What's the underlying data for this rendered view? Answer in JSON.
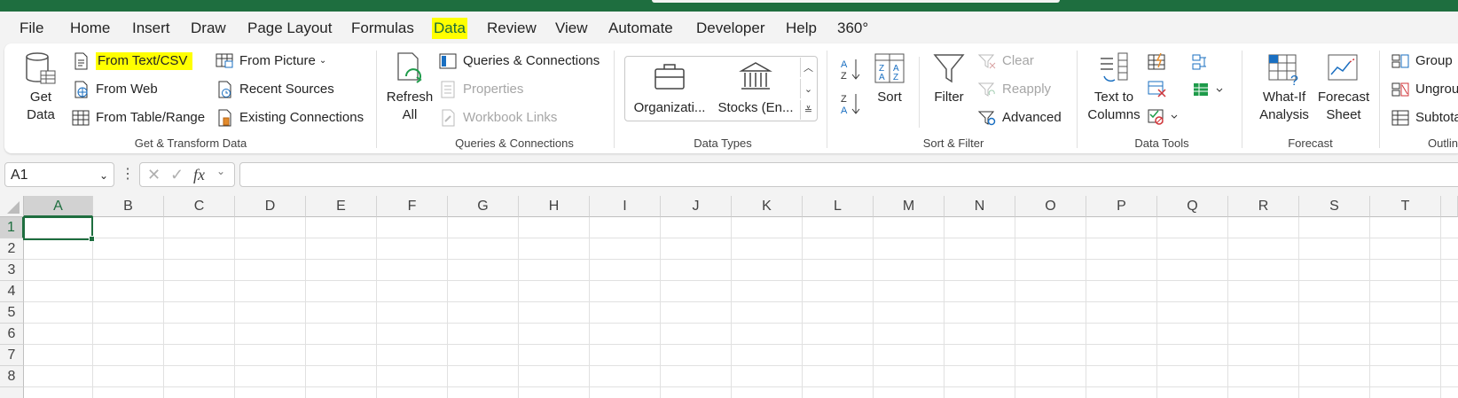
{
  "menu": {
    "tabs": [
      "File",
      "Home",
      "Insert",
      "Draw",
      "Page Layout",
      "Formulas",
      "Data",
      "Review",
      "View",
      "Automate",
      "Developer",
      "Help",
      "360°"
    ],
    "active": "Data"
  },
  "ribbon": {
    "get_transform": {
      "get_data": "Get Data",
      "from_text_csv": "From Text/CSV",
      "from_web": "From Web",
      "from_table_range": "From Table/Range",
      "from_picture": "From Picture",
      "recent_sources": "Recent Sources",
      "existing_connections": "Existing Connections",
      "group_label": "Get & Transform Data"
    },
    "queries": {
      "refresh_all": "Refresh All",
      "queries_connections": "Queries & Connections",
      "properties": "Properties",
      "workbook_links": "Workbook Links",
      "group_label": "Queries & Connections"
    },
    "data_types": {
      "organization": "Organizati...",
      "stocks": "Stocks (En...",
      "group_label": "Data Types"
    },
    "sort_filter": {
      "sort": "Sort",
      "filter": "Filter",
      "clear": "Clear",
      "reapply": "Reapply",
      "advanced": "Advanced",
      "group_label": "Sort & Filter"
    },
    "data_tools": {
      "text_to_columns": "Text to Columns",
      "group_label": "Data Tools"
    },
    "forecast": {
      "what_if": "What-If Analysis",
      "forecast_sheet": "Forecast Sheet",
      "group_label": "Forecast"
    },
    "outline": {
      "group": "Group",
      "ungroup": "Ungrou",
      "subtotal": "Subtota",
      "group_label": "Outlin"
    }
  },
  "formula_bar": {
    "name_box": "A1",
    "fx": "fx",
    "formula": ""
  },
  "grid": {
    "columns": [
      "A",
      "B",
      "C",
      "D",
      "E",
      "F",
      "G",
      "H",
      "I",
      "J",
      "K",
      "L",
      "M",
      "N",
      "O",
      "P",
      "Q",
      "R",
      "S",
      "T"
    ],
    "rows": [
      "1",
      "2",
      "3",
      "4",
      "5",
      "6",
      "7",
      "8"
    ],
    "selected_cell": "A1"
  },
  "colors": {
    "title_bar": "#1e6e3f",
    "highlight": "#ffff00",
    "accent": "#1e6e3f"
  }
}
